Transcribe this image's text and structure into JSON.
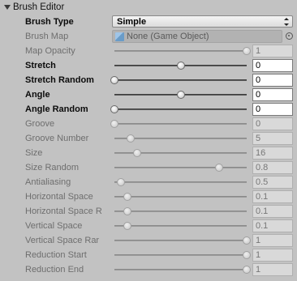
{
  "header": {
    "title": "Brush Editor"
  },
  "brush_type": {
    "label": "Brush Type",
    "value": "Simple"
  },
  "brush_map": {
    "label": "Brush Map",
    "value": "None (Game Object)"
  },
  "sliders": [
    {
      "label": "Map Opacity",
      "value": "1",
      "fraction": 1.0,
      "enabled": false,
      "bold": false
    },
    {
      "label": "Stretch",
      "value": "0",
      "fraction": 0.5,
      "enabled": true,
      "bold": true
    },
    {
      "label": "Stretch Random",
      "value": "0",
      "fraction": 0.0,
      "enabled": true,
      "bold": true
    },
    {
      "label": "Angle",
      "value": "0",
      "fraction": 0.5,
      "enabled": true,
      "bold": true
    },
    {
      "label": "Angle Random",
      "value": "0",
      "fraction": 0.0,
      "enabled": true,
      "bold": true
    },
    {
      "label": "Groove",
      "value": "0",
      "fraction": 0.0,
      "enabled": false,
      "bold": false
    },
    {
      "label": "Groove Number",
      "value": "5",
      "fraction": 0.12,
      "enabled": false,
      "bold": false
    },
    {
      "label": "Size",
      "value": "16",
      "fraction": 0.17,
      "enabled": false,
      "bold": false
    },
    {
      "label": "Size Random",
      "value": "0.8",
      "fraction": 0.79,
      "enabled": false,
      "bold": false
    },
    {
      "label": "Antialiasing",
      "value": "0.5",
      "fraction": 0.05,
      "enabled": false,
      "bold": false
    },
    {
      "label": "Horizontal Space",
      "value": "0.1",
      "fraction": 0.1,
      "enabled": false,
      "bold": false
    },
    {
      "label": "Horizontal Space R",
      "value": "0.1",
      "fraction": 0.1,
      "enabled": false,
      "bold": false
    },
    {
      "label": "Vertical Space",
      "value": "0.1",
      "fraction": 0.1,
      "enabled": false,
      "bold": false
    },
    {
      "label": "Vertical Space Rar",
      "value": "1",
      "fraction": 1.0,
      "enabled": false,
      "bold": false
    },
    {
      "label": "Reduction Start",
      "value": "1",
      "fraction": 1.0,
      "enabled": false,
      "bold": false
    },
    {
      "label": "Reduction End",
      "value": "1",
      "fraction": 1.0,
      "enabled": false,
      "bold": false
    }
  ],
  "colors": {
    "background": "#c2c2c2",
    "field_enabled": "#ffffff",
    "field_disabled": "#d9d9d9"
  }
}
